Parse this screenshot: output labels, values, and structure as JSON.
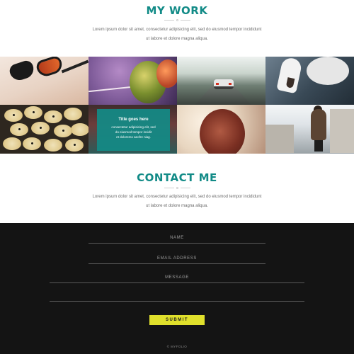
{
  "work": {
    "heading": "MY WORK",
    "para_line1": "Lorem ipsum dolor sit amet, consectetur adipisicing elit, sed do eiusmod tempor incididunt",
    "para_line2": "ut labore et dolore magna aliqua.",
    "hover_caption": {
      "title": "Title goes here",
      "line1": "consectetur adipisicing elit, sed",
      "line2": "do eiusmod tempor incidit",
      "line3": "et doloremo aeofre niag."
    }
  },
  "contact": {
    "heading": "CONTACT ME",
    "para_line1": "Lorem ipsum dolor sit amet, consectetur adipisicing elit, sed do eiusmod tempor incididunt",
    "para_line2": "ut labore et dolore magna aliqua."
  },
  "form": {
    "name_label": "NAME",
    "email_label": "EMAIL ADDRESS",
    "message_label": "MESSAGE",
    "submit_label": "SUBMIT"
  },
  "footer": {
    "text": "© MYFOLIO"
  },
  "colors": {
    "accent": "#128b87",
    "button": "#e0e02c",
    "dark_bg": "#141414"
  }
}
